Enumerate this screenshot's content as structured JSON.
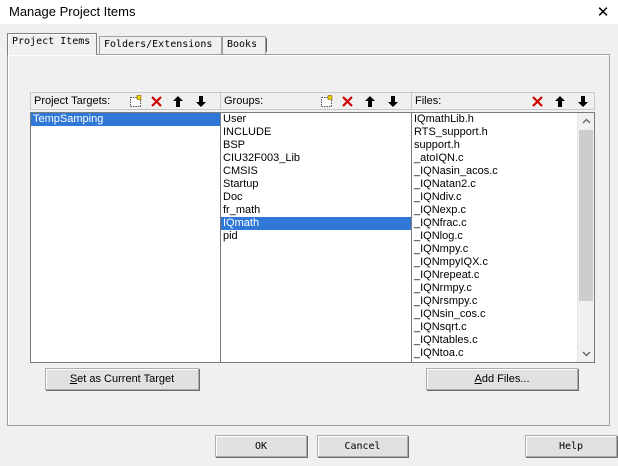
{
  "window": {
    "title": "Manage Project Items",
    "close_glyph": "✕"
  },
  "tabs": [
    {
      "label": "Project Items",
      "active": true
    },
    {
      "label": "Folders/Extensions",
      "active": false
    },
    {
      "label": "Books",
      "active": false
    }
  ],
  "targets_pane": {
    "label": "Project Targets:",
    "items": [
      "TempSamping"
    ],
    "selected_index": 0,
    "toolbar": [
      "new-icon",
      "delete-icon",
      "move-up-icon",
      "move-down-icon"
    ]
  },
  "groups_pane": {
    "label": "Groups:",
    "items": [
      "User",
      "INCLUDE",
      "BSP",
      "CIU32F003_Lib",
      "CMSIS",
      "Startup",
      "Doc",
      "fr_math",
      "IQmath",
      "pid"
    ],
    "selected_index": 8,
    "toolbar": [
      "new-icon",
      "delete-icon",
      "move-up-icon",
      "move-down-icon"
    ]
  },
  "files_pane": {
    "label": "Files:",
    "items": [
      "IQmathLib.h",
      "RTS_support.h",
      "support.h",
      "_atoIQN.c",
      "_IQNasin_acos.c",
      "_IQNatan2.c",
      "_IQNdiv.c",
      "_IQNexp.c",
      "_IQNfrac.c",
      "_IQNlog.c",
      "_IQNmpy.c",
      "_IQNmpyIQX.c",
      "_IQNrepeat.c",
      "_IQNrmpy.c",
      "_IQNrsmpy.c",
      "_IQNsin_cos.c",
      "_IQNsqrt.c",
      "_IQNtables.c",
      "_IQNtoa.c"
    ],
    "toolbar": [
      "delete-icon",
      "move-up-icon",
      "move-down-icon"
    ],
    "scroll_position": 0.0
  },
  "buttons": {
    "set_current_target": "Set as Current Target",
    "add_files": "Add Files...",
    "ok": "OK",
    "cancel": "Cancel",
    "help": "Help"
  },
  "colors": {
    "selection": "#3078d8",
    "delete_red": "#cc0000"
  }
}
